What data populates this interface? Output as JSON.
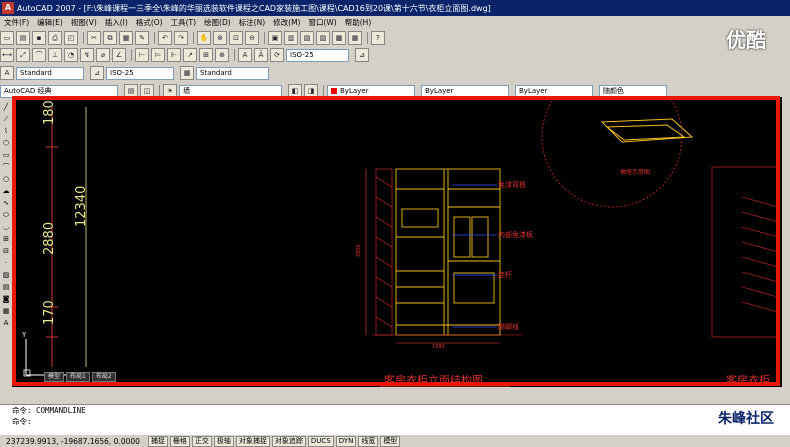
{
  "titlebar": {
    "title": "AutoCAD 2007 - [F:\\朱峰课程一三季全\\朱峰的华丽选装软件课程之CAD家装施工图\\课程\\CAD16到20课\\第十六节\\衣柜立面图.dwg]",
    "app_icon": "A"
  },
  "menubar": {
    "items": [
      "文件(F)",
      "编辑(E)",
      "视图(V)",
      "插入(I)",
      "格式(O)",
      "工具(T)",
      "绘图(D)",
      "标注(N)",
      "修改(M)",
      "窗口(W)",
      "帮助(H)"
    ]
  },
  "toolbar_styles": {
    "text_style": "Standard",
    "dim_style": "ISO-25",
    "table_style": "Standard"
  },
  "toolbar_props": {
    "workspace": "AutoCAD 经典",
    "layer": "墙",
    "color": "ByLayer",
    "linetype": "ByLayer",
    "lineweight": "ByLayer",
    "plotstyle": "随颜色",
    "accent_color": "#e00000"
  },
  "drawing": {
    "dimensions": [
      "180",
      "2880",
      "12340",
      "170"
    ],
    "annotations": [
      "免漆背板",
      "内部免漆板",
      "挂杆",
      "踢脚线"
    ],
    "width_dim": "1990",
    "height_dim": "2850",
    "title_main": "客房衣柜立面结构图",
    "title_right": "客房衣柜",
    "detail_label": "抽屉示意图"
  },
  "tabs": [
    "模型",
    "布局1",
    "布局2"
  ],
  "command": {
    "line1": "命令: COMMANDLINE",
    "line2": "命令:"
  },
  "status": {
    "coords": "237239.9913, -19687.1656, 0.0000",
    "buttons": [
      "捕捉",
      "栅格",
      "正交",
      "极轴",
      "对象捕捉",
      "对象追踪",
      "DUCS",
      "DYN",
      "线宽",
      "模型"
    ]
  },
  "watermarks": {
    "top": "优酷",
    "bottom": "朱峰社区"
  },
  "colors": {
    "highlight": "#e8170a",
    "canvas": "#000000",
    "dim_text": "#e6e68a",
    "furniture_line": "#f0c020",
    "annotation": "#e03030",
    "dim_line": "#ff4040"
  }
}
